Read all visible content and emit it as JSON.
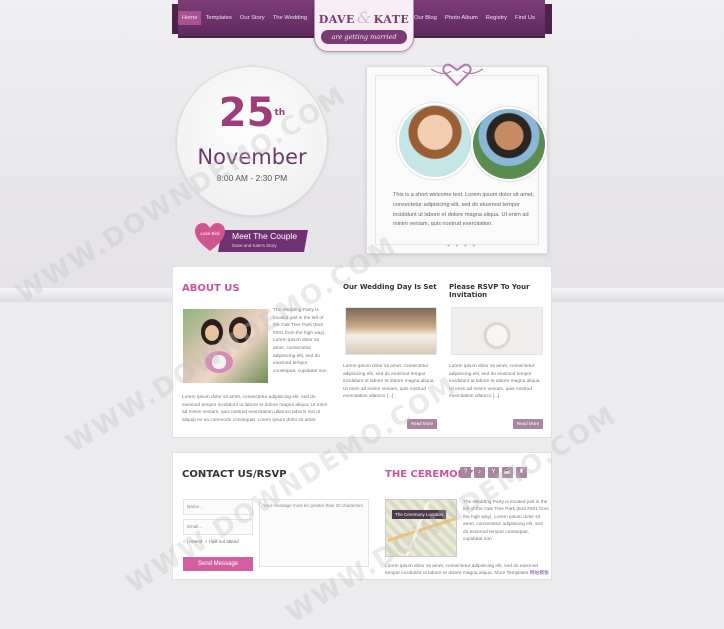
{
  "nav": {
    "left_items": [
      "Home",
      "Templates",
      "Our Story",
      "The Wedding"
    ],
    "right_items": [
      "Our Blog",
      "Photo Album",
      "Registry",
      "Find Us"
    ],
    "active": "Home"
  },
  "logo": {
    "name1": "DAVE",
    "amp": "&",
    "name2": "KATE",
    "tagline": "are getting married"
  },
  "date": {
    "day": "25",
    "suffix": "th",
    "month": "November",
    "time": "8:00 AM - 2:30 PM"
  },
  "meet": {
    "heart_text": "Love Bird",
    "title": "Meet The Couple",
    "subtitle": "Dave and Kate's Story"
  },
  "welcome": {
    "text": "This is a short welcome text. Lorem ipsum dolor sit amet, consectetur adipisicing elit, sed do eiusmod tempor incididunt ut labore et dolore magna aliqua. Ut enim ad minim veniam, quis nostrud exercitation."
  },
  "about": {
    "heading": "ABOUT US",
    "side_text": "The Wedding Party is located just in the left of the Oak Tree Park (Exit #201 from the high way). Lorem ipsum dolor sit amet, consectetur adipisicing elit, sed do eiusmod tempor consequat, cupidatat non",
    "full_text": "Lorem ipsum dolor sit amet, consectetur adipisicing elit, sed do eiusmod tempor incididunt ut labore et dolore magna aliqua. Ut enim ad minim veniam, quis nostrud exercitation ullamco laboris nisi ut aliquip ex ea commodo consequat. Lorem ipsum dolor sit amet."
  },
  "col1": {
    "heading": "Our Wedding Day Is Set",
    "text": "Lorem ipsum dolor sit amet, consectetur adipisicing elit, sed do eiusmod tempor incididunt ut labore et dolore magna aliqua. Ut enim ad minim veniam, quis nostrud exercitation ullamco [...]",
    "read_more": "Read More"
  },
  "col2": {
    "heading": "Please RSVP To Your Invitation",
    "text": "Lorem ipsum dolor sit amet, consectetur adipisicing elit, sed do eiusmod tempor incididunt ut labore et dolore magna aliqua. Ut enim ad minim veniam, quis nostrud exercitation ullamco [...]",
    "read_more": "Read More"
  },
  "contact": {
    "heading": "CONTACT US/RSVP",
    "name_placeholder": "Name...",
    "email_placeholder": "Email...",
    "message_placeholder": "Your message must be greater than 20 characters",
    "radio1": "I Attend",
    "radio2": "I will not attend",
    "send": "Send Message"
  },
  "ceremony": {
    "heading": "THE CEREMONY",
    "icons": [
      "?",
      "♪",
      "Y",
      "☕",
      "♜"
    ],
    "map_label": "The Ceremony Location",
    "side_text": "The Wedding Party is located just in the left of the Oak Tree Park (Exit #201 from the high way). Lorem ipsum dolor sit amet, consectetur adipisicing elit, sed do eiusmod tempor consequat, cupidatat non",
    "full_text": "Lorem ipsum dolor sit amet, consectetur adipisicing elit, sed do eiusmod tempor incididunt ut labore et dolore magna aliqua. More Templates ",
    "link_text": "网站模板"
  },
  "watermark": "WWW.DOWNDEMO.COM"
}
